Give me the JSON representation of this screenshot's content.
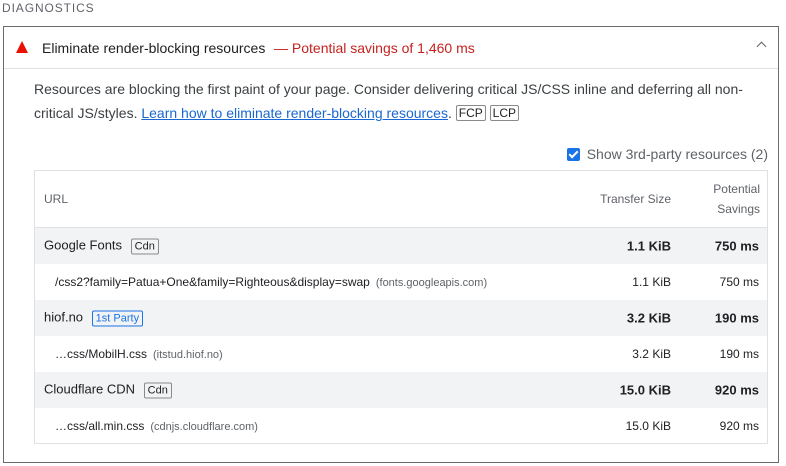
{
  "section_title": "DIAGNOSTICS",
  "audit": {
    "title": "Eliminate render-blocking resources",
    "savings": "— Potential savings of 1,460 ms",
    "description_text": "Resources are blocking the first paint of your page. Consider delivering critical JS/CSS inline and deferring all non-critical JS/styles. ",
    "learn_link": "Learn how to eliminate render-blocking resources",
    "period": ".",
    "metric_tags": [
      "FCP",
      "LCP"
    ],
    "show_3rd_party": "Show 3rd-party resources (2)",
    "show_3rd_party_checked": true
  },
  "table": {
    "headers": {
      "url": "URL",
      "transfer_size": "Transfer Size",
      "potential": "Potential",
      "savings": "Savings"
    },
    "groups": [
      {
        "name": "Google Fonts",
        "tag": "Cdn",
        "size": "1.1 KiB",
        "savings": "750 ms",
        "items": [
          {
            "url": "/css2?family=Patua+One&family=Righteous&display=swap",
            "host": "(fonts.googleapis.com)",
            "size": "1.1 KiB",
            "savings": "750 ms"
          }
        ]
      },
      {
        "name": "hiof.no",
        "tag": "1st Party",
        "size": "3.2 KiB",
        "savings": "190 ms",
        "items": [
          {
            "url": "…css/MobilH.css",
            "host": "(itstud.hiof.no)",
            "size": "3.2 KiB",
            "savings": "190 ms"
          }
        ]
      },
      {
        "name": "Cloudflare CDN",
        "tag": "Cdn",
        "size": "15.0 KiB",
        "savings": "920 ms",
        "items": [
          {
            "url": "…css/all.min.css",
            "host": "(cdnjs.cloudflare.com)",
            "size": "15.0 KiB",
            "savings": "920 ms"
          }
        ]
      }
    ]
  },
  "colors": {
    "fail": "#eb0f00",
    "savings_text": "#c5221f",
    "link": "#1967d2",
    "checkbox": "#1a73e8",
    "group_bg": "#f1f3f4"
  }
}
